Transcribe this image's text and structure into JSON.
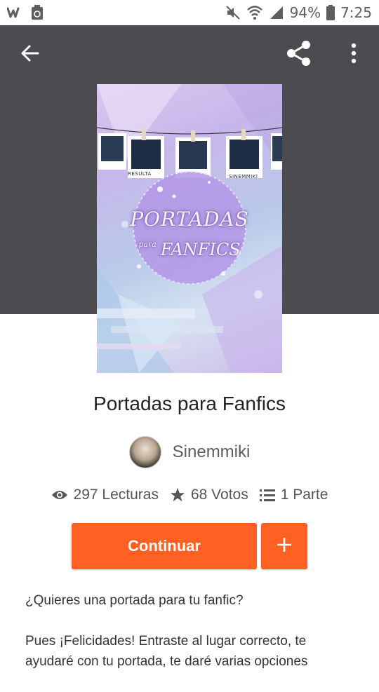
{
  "status_bar": {
    "battery": "94%",
    "time": "7:25",
    "icons": [
      "wattpad-icon",
      "recycle-icon",
      "mute-icon",
      "wifi-icon",
      "signal-icon",
      "battery-icon"
    ]
  },
  "toolbar": {
    "back_icon": "arrow-back-icon",
    "share_icon": "share-icon",
    "more_icon": "more-vert-icon"
  },
  "cover": {
    "title": "PORTADAS",
    "subtitle_small": "para",
    "subtitle": "FANFICS",
    "photo_label_left": "RESULTA",
    "photo_label_right": "SINEMMIKI"
  },
  "story": {
    "title": "Portadas para Fanfics",
    "author": "Sinemmiki"
  },
  "stats": {
    "reads": "297 Lecturas",
    "votes": "68 Votos",
    "parts": "1 Parte"
  },
  "actions": {
    "continue_label": "Continuar",
    "add_label": "+"
  },
  "description": {
    "line1": "¿Quieres una portada para tu fanfic?",
    "line2": "Pues ¡Felicidades! Entraste al lugar correcto, te ayudaré con tu portada, te daré varias opciones"
  },
  "colors": {
    "header_bg": "#4c4b50",
    "accent": "#ff6122"
  }
}
